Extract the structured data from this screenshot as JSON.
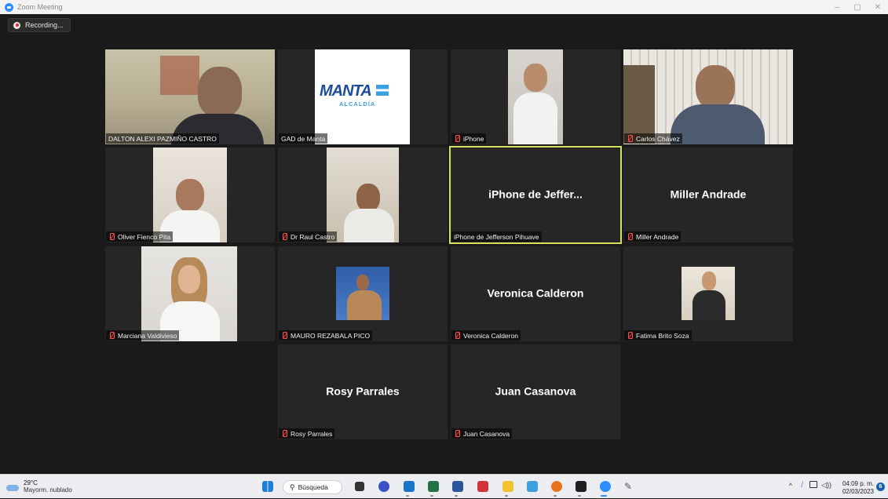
{
  "window": {
    "title": "Zoom Meeting",
    "controls": [
      "–",
      "▢",
      "✕"
    ]
  },
  "recording": {
    "label": "Recording..."
  },
  "participants": [
    {
      "name": "DALTON ALEXI PAZMIÑO CASTRO",
      "muted": false,
      "video": true,
      "display": ""
    },
    {
      "name": "GAD de Manta",
      "muted": false,
      "video": true,
      "display": ""
    },
    {
      "name": "iPhone",
      "muted": true,
      "video": true,
      "display": ""
    },
    {
      "name": "Carlos Chávez",
      "muted": true,
      "video": true,
      "display": ""
    },
    {
      "name": "Oliver Fienco Pita",
      "muted": true,
      "video": true,
      "display": ""
    },
    {
      "name": "Dr Raul Castro",
      "muted": true,
      "video": true,
      "display": ""
    },
    {
      "name": "iPhone de Jefferson Pihuave",
      "muted": false,
      "video": false,
      "display": "iPhone de Jeffer...",
      "active": true
    },
    {
      "name": "Miller Andrade",
      "muted": true,
      "video": false,
      "display": "Miller Andrade"
    },
    {
      "name": "Marciana Valdivieso",
      "muted": true,
      "video": true,
      "display": ""
    },
    {
      "name": "MAURO REZABALA PICO",
      "muted": true,
      "video": true,
      "display": ""
    },
    {
      "name": "Veronica Calderon",
      "muted": true,
      "video": false,
      "display": "Veronica Calderon"
    },
    {
      "name": "Fatima Brito Soza",
      "muted": true,
      "video": true,
      "display": ""
    },
    {
      "name": "Rosy Parrales",
      "muted": true,
      "video": false,
      "display": "Rosy Parrales"
    },
    {
      "name": "Juan Casanova",
      "muted": true,
      "video": false,
      "display": "Juan Casanova"
    }
  ],
  "logo": {
    "brand": "MANTA",
    "subtitle": "ALCALDÍA"
  },
  "taskbar": {
    "weather_temp": "29°C",
    "weather_desc": "Mayorm. nublado",
    "search_label": "Búsqueda",
    "time": "04:09 p. m.",
    "date": "02/03/2023",
    "notification_count": "6"
  },
  "colors": {
    "active_border": "#d6e05a",
    "tile_bg": "#262626",
    "muted_icon": "#ff3a3a"
  }
}
